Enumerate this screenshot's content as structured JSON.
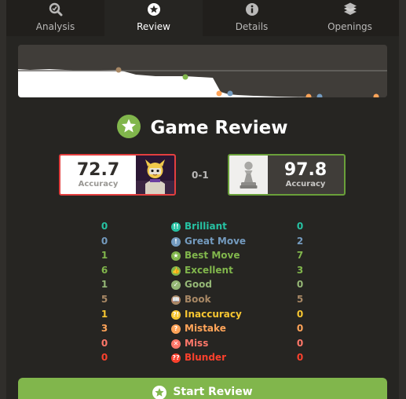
{
  "tabs": [
    {
      "label": "Analysis",
      "icon": "magnifier-icon",
      "active": false
    },
    {
      "label": "Review",
      "icon": "star-icon",
      "active": true
    },
    {
      "label": "Details",
      "icon": "info-icon",
      "active": false
    },
    {
      "label": "Openings",
      "icon": "book-icon",
      "active": false
    }
  ],
  "title": "Game Review",
  "white": {
    "accuracy": "72.7",
    "accuracy_label": "Accuracy",
    "avatar": "cartoon-avatar"
  },
  "black": {
    "accuracy": "97.8",
    "accuracy_label": "Accuracy",
    "avatar": "pawn-avatar"
  },
  "result": "0-1",
  "classifications": [
    {
      "name": "Brilliant",
      "white": "0",
      "black": "0",
      "color": "#26c2a3",
      "symbol": "!!"
    },
    {
      "name": "Great Move",
      "white": "0",
      "black": "2",
      "color": "#749bbf",
      "symbol": "!"
    },
    {
      "name": "Best Move",
      "white": "1",
      "black": "7",
      "color": "#81b64c",
      "symbol": "★"
    },
    {
      "name": "Excellent",
      "white": "6",
      "black": "3",
      "color": "#81b64c",
      "symbol": "👍"
    },
    {
      "name": "Good",
      "white": "1",
      "black": "0",
      "color": "#95b776",
      "symbol": "✓"
    },
    {
      "name": "Book",
      "white": "5",
      "black": "5",
      "color": "#a88865",
      "symbol": "📖"
    },
    {
      "name": "Inaccuracy",
      "white": "1",
      "black": "0",
      "color": "#f7c631",
      "symbol": "?!"
    },
    {
      "name": "Mistake",
      "white": "3",
      "black": "0",
      "color": "#ffa459",
      "symbol": "?"
    },
    {
      "name": "Miss",
      "white": "0",
      "black": "0",
      "color": "#ff7769",
      "symbol": "✕"
    },
    {
      "name": "Blunder",
      "white": "0",
      "black": "0",
      "color": "#fa412d",
      "symbol": "??"
    }
  ],
  "button": {
    "label": "Start Review"
  },
  "colors": {
    "accent_green": "#81b64c",
    "white_border": "#e33f3f",
    "black_border": "#6aa03a"
  }
}
